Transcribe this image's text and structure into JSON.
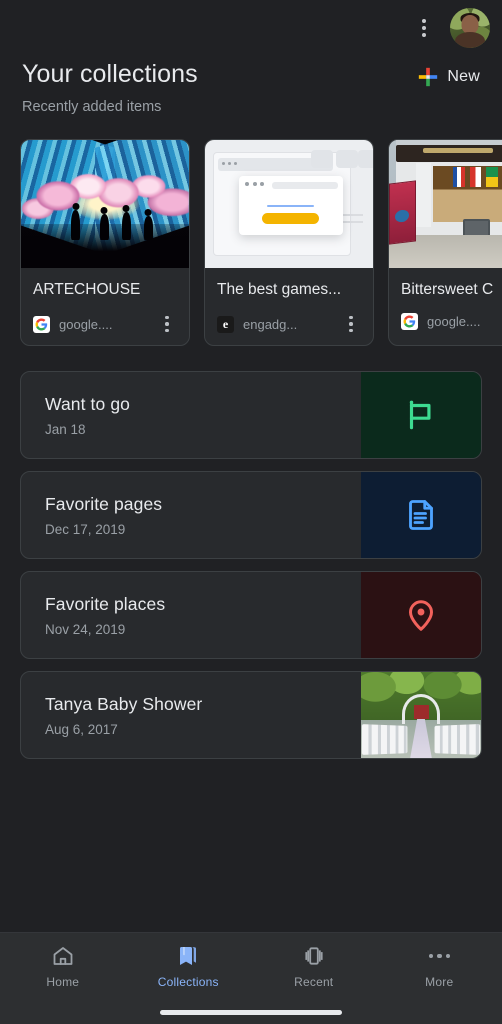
{
  "app": {
    "theme": "dark",
    "background_color": "#202124"
  },
  "topbar": {
    "overflow_menu": "more-options",
    "avatar_label": "Account"
  },
  "header": {
    "title": "Your collections",
    "subtitle": "Recently added items",
    "new_button_label": "New"
  },
  "recent_cards": [
    {
      "title": "ARTECHOUSE",
      "source": "google....",
      "favicon": "google-icon",
      "thumb": "immersive-art-installation"
    },
    {
      "title": "The best games...",
      "source": "engadg...",
      "favicon": "engadget-icon",
      "thumb": "browser-window-illustration"
    },
    {
      "title": "Bittersweet C",
      "source": "google....",
      "favicon": "google-icon",
      "thumb": "storefront-photo"
    }
  ],
  "collections": [
    {
      "title": "Want to go",
      "date": "Jan 18",
      "tile_type": "icon",
      "icon": "flag-icon",
      "icon_color": "#3ddc91",
      "tile_color": "#0b2a1c"
    },
    {
      "title": "Favorite pages",
      "date": "Dec 17, 2019",
      "tile_type": "icon",
      "icon": "document-icon",
      "icon_color": "#4da3ff",
      "tile_color": "#0d1d33"
    },
    {
      "title": "Favorite places",
      "date": "Nov 24, 2019",
      "tile_type": "icon",
      "icon": "location-pin-icon",
      "icon_color": "#f2625c",
      "tile_color": "#2b1113"
    },
    {
      "title": "Tanya Baby Shower",
      "date": "Aug 6, 2017",
      "tile_type": "photo",
      "icon": "wedding-venue-photo",
      "icon_color": "",
      "tile_color": "#3c5c2a"
    }
  ],
  "bottom_nav": {
    "items": [
      {
        "label": "Home",
        "icon": "home-icon",
        "active": false
      },
      {
        "label": "Collections",
        "icon": "collections-bookmark-icon",
        "active": true
      },
      {
        "label": "Recent",
        "icon": "recent-tabs-icon",
        "active": false
      },
      {
        "label": "More",
        "icon": "more-horizontal-icon",
        "active": false
      }
    ],
    "active_color": "#8ab4f8",
    "inactive_color": "#9aa0a6"
  }
}
